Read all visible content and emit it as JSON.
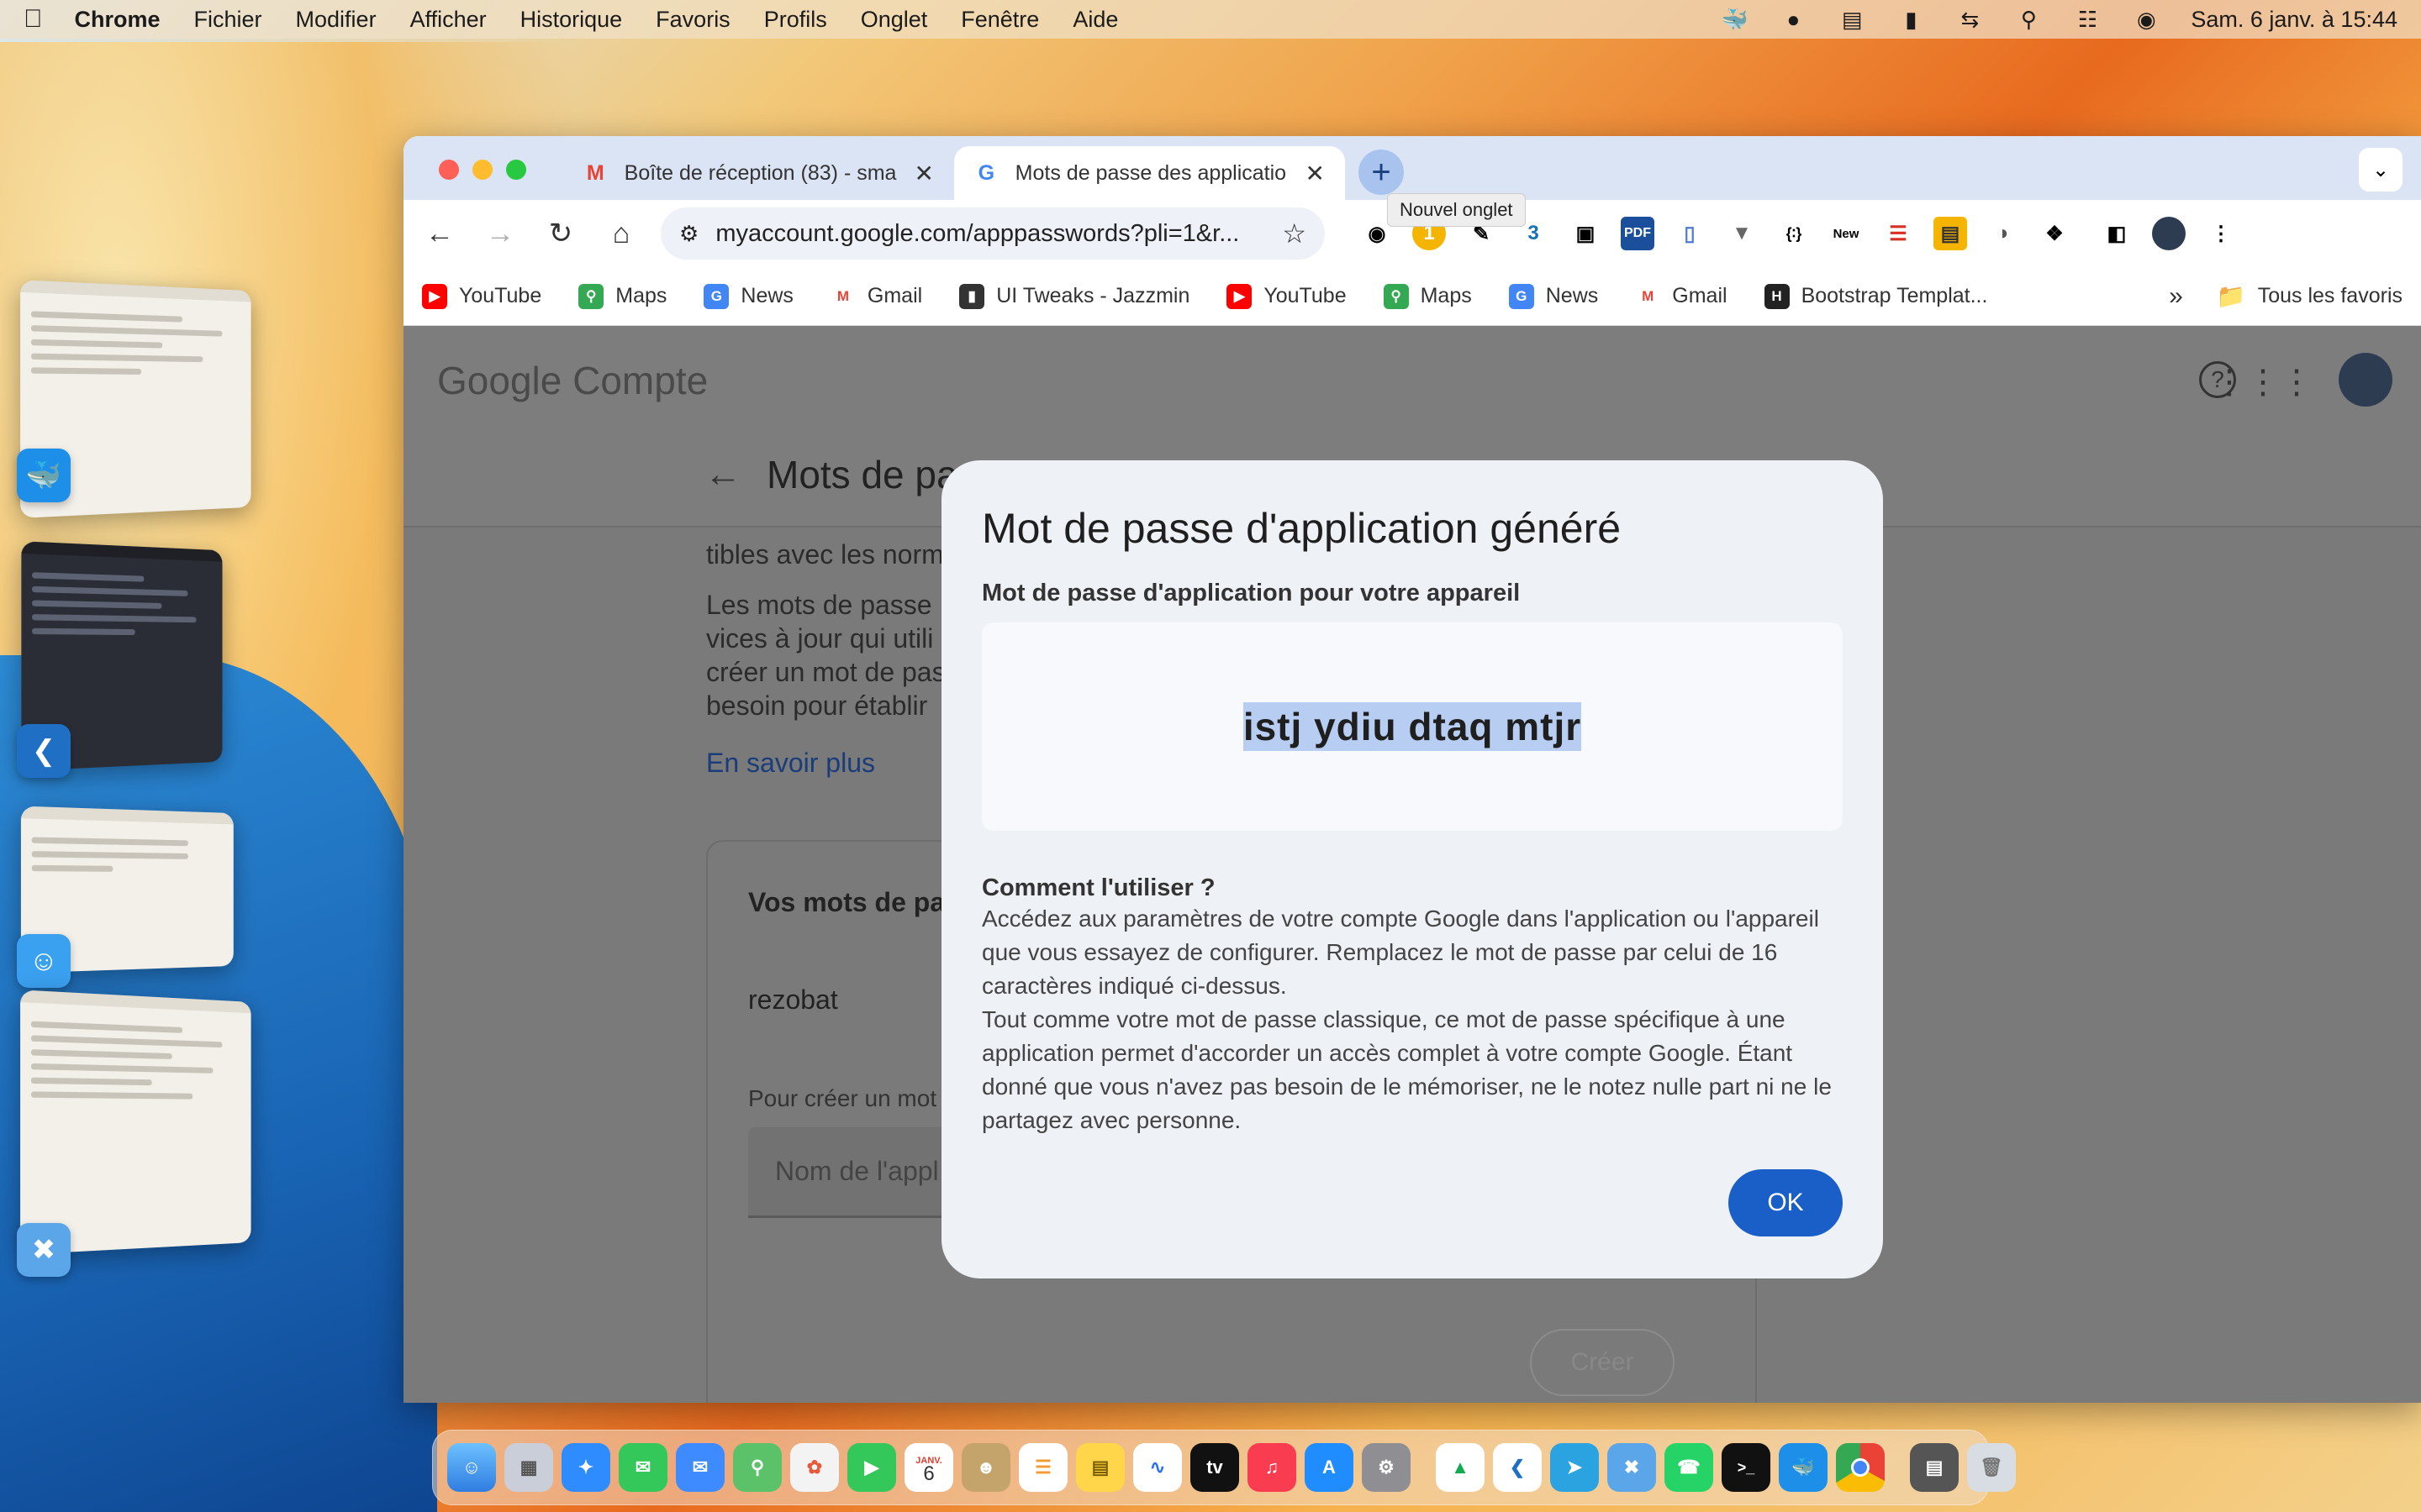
{
  "menubar": {
    "app": "Chrome",
    "items": [
      "Fichier",
      "Modifier",
      "Afficher",
      "Historique",
      "Favoris",
      "Profils",
      "Onglet",
      "Fenêtre",
      "Aide"
    ],
    "clock": "Sam. 6 janv. à 15:44"
  },
  "browser": {
    "tabs": [
      {
        "label": "Boîte de réception (83) - sma",
        "icon": "gmail-icon"
      },
      {
        "label": "Mots de passe des applicatio",
        "icon": "google-icon"
      }
    ],
    "tooltip": "Nouvel onglet",
    "url": "myaccount.google.com/apppasswords?pli=1&r...",
    "ext_new_label": "New",
    "ext_pdf_label": "PDF",
    "ext_badge": "1",
    "bookmarks": [
      {
        "label": "YouTube",
        "icon": "youtube-icon",
        "color": "#ff0000"
      },
      {
        "label": "Maps",
        "icon": "maps-icon",
        "color": "#34a853"
      },
      {
        "label": "News",
        "icon": "news-icon",
        "color": "#4285f4"
      },
      {
        "label": "Gmail",
        "icon": "gmail-icon",
        "color": "#ea4335"
      },
      {
        "label": "UI Tweaks - Jazzmin",
        "icon": "book-icon",
        "color": "#333333"
      },
      {
        "label": "YouTube",
        "icon": "youtube-icon",
        "color": "#ff0000"
      },
      {
        "label": "Maps",
        "icon": "maps-icon",
        "color": "#34a853"
      },
      {
        "label": "News",
        "icon": "news-icon",
        "color": "#4285f4"
      },
      {
        "label": "Gmail",
        "icon": "gmail-icon",
        "color": "#ea4335"
      },
      {
        "label": "Bootstrap Templat...",
        "icon": "bootstrap-icon",
        "color": "#222222"
      }
    ],
    "all_bookmarks": "Tous les favoris"
  },
  "page": {
    "logo_google": "Google",
    "logo_compte": "Compte",
    "title": "Mots de pa",
    "text_line0": "tibles avec les norm",
    "text_lines": [
      "Les mots de passe",
      "vices à jour qui utili",
      "créer un mot de pas",
      "besoin pour établir"
    ],
    "learn_more": "En savoir plus",
    "card_heading": "Vos mots de pa",
    "app_name": "rezobat",
    "create_hint": "Pour créer un mot",
    "field_placeholder": "Nom de l'appl",
    "create_button": "Créer"
  },
  "modal": {
    "title": "Mot de passe d'application généré",
    "subtitle": "Mot de passe d'application pour votre appareil",
    "password": "istj ydiu dtaq mtjr",
    "howto_title": "Comment l'utiliser ?",
    "para1": "Accédez aux paramètres de votre compte Google dans l'application ou l'appareil que vous essayez de configurer. Remplacez le mot de passe par celui de 16 caractères indiqué ci-dessus.",
    "para2": "Tout comme votre mot de passe classique, ce mot de passe spécifique à une application permet d'accorder un accès complet à votre compte Google. Étant donné que vous n'avez pas besoin de le mémoriser, ne le notez nulle part ni ne le partagez avec personne.",
    "ok": "OK"
  },
  "dock": {
    "calendar_month": "JANV.",
    "calendar_day": "6"
  },
  "colors": {
    "accent": "#1a5fc8",
    "link": "#1a3d7a",
    "selection": "#b7cdf1",
    "tabstrip": "#dbe4f4"
  }
}
